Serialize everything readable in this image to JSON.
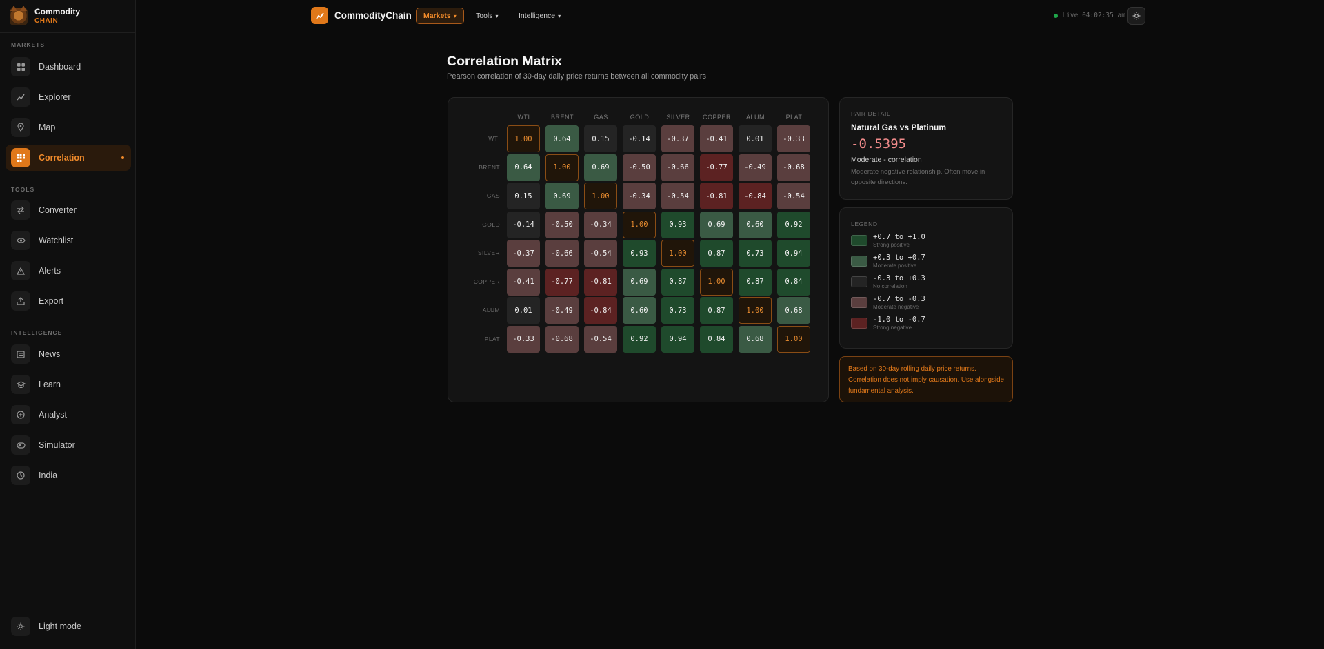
{
  "brand": {
    "name": "Commodity",
    "sub": "CHAIN"
  },
  "sidebar": {
    "sections": [
      "MARKETS",
      "TOOLS",
      "INTELLIGENCE"
    ],
    "items": [
      {
        "label": "Dashboard",
        "icon": "grid-icon"
      },
      {
        "label": "Explorer",
        "icon": "trend-icon"
      },
      {
        "label": "Map",
        "icon": "pin-icon"
      },
      {
        "label": "Correlation",
        "icon": "matrix-icon",
        "active": true
      },
      {
        "label": "Converter",
        "icon": "swap-icon"
      },
      {
        "label": "Watchlist",
        "icon": "eye-icon"
      },
      {
        "label": "Alerts",
        "icon": "warning-icon"
      },
      {
        "label": "Export",
        "icon": "upload-icon"
      },
      {
        "label": "News",
        "icon": "news-icon"
      },
      {
        "label": "Learn",
        "icon": "cap-icon"
      },
      {
        "label": "Analyst",
        "icon": "plus-circle-icon"
      },
      {
        "label": "Simulator",
        "icon": "toggle-icon"
      },
      {
        "label": "India",
        "icon": "clock-icon"
      }
    ],
    "light_mode_label": "Light mode"
  },
  "topbar": {
    "app_name": "CommodityChain",
    "menus": [
      "Markets",
      "Tools",
      "Intelligence"
    ],
    "live_text": "Live 04:02:35 am"
  },
  "page": {
    "title": "Correlation Matrix",
    "subtitle": "Pearson correlation of 30-day daily price returns between all commodity pairs"
  },
  "matrix": {
    "labels": [
      "WTI",
      "BRENT",
      "GAS",
      "GOLD",
      "SILVER",
      "COPPER",
      "ALUM",
      "PLAT"
    ],
    "values": [
      [
        1.0,
        0.64,
        0.15,
        -0.14,
        -0.37,
        -0.41,
        0.01,
        -0.33
      ],
      [
        0.64,
        1.0,
        0.69,
        -0.5,
        -0.66,
        -0.77,
        -0.49,
        -0.68
      ],
      [
        0.15,
        0.69,
        1.0,
        -0.34,
        -0.54,
        -0.81,
        -0.84,
        -0.54
      ],
      [
        -0.14,
        -0.5,
        -0.34,
        1.0,
        0.93,
        0.69,
        0.6,
        0.92
      ],
      [
        -0.37,
        -0.66,
        -0.54,
        0.93,
        1.0,
        0.87,
        0.73,
        0.94
      ],
      [
        -0.41,
        -0.77,
        -0.81,
        0.69,
        0.87,
        1.0,
        0.87,
        0.84
      ],
      [
        0.01,
        -0.49,
        -0.84,
        0.6,
        0.73,
        0.87,
        1.0,
        0.68
      ],
      [
        -0.33,
        -0.68,
        -0.54,
        0.92,
        0.94,
        0.84,
        0.68,
        1.0
      ]
    ]
  },
  "pair_detail": {
    "label": "PAIR DETAIL",
    "title": "Natural Gas vs Platinum",
    "value": "-0.5395",
    "strength": "Moderate - correlation",
    "description": "Moderate negative relationship. Often move in opposite directions."
  },
  "legend": {
    "label": "LEGEND",
    "items": [
      {
        "range": "+0.7 to +1.0",
        "desc": "Strong positive",
        "color": "#1f4a2c"
      },
      {
        "range": "+0.3 to +0.7",
        "desc": "Moderate positive",
        "color": "#3a5a44"
      },
      {
        "range": "-0.3 to +0.3",
        "desc": "No correlation",
        "color": "#242424"
      },
      {
        "range": "-0.7 to -0.3",
        "desc": "Moderate negative",
        "color": "#5a3e3e"
      },
      {
        "range": "-1.0 to -0.7",
        "desc": "Strong negative",
        "color": "#5c2222"
      }
    ]
  },
  "note": "Based on 30-day rolling daily price returns. Correlation does not imply causation. Use alongside fundamental analysis."
}
